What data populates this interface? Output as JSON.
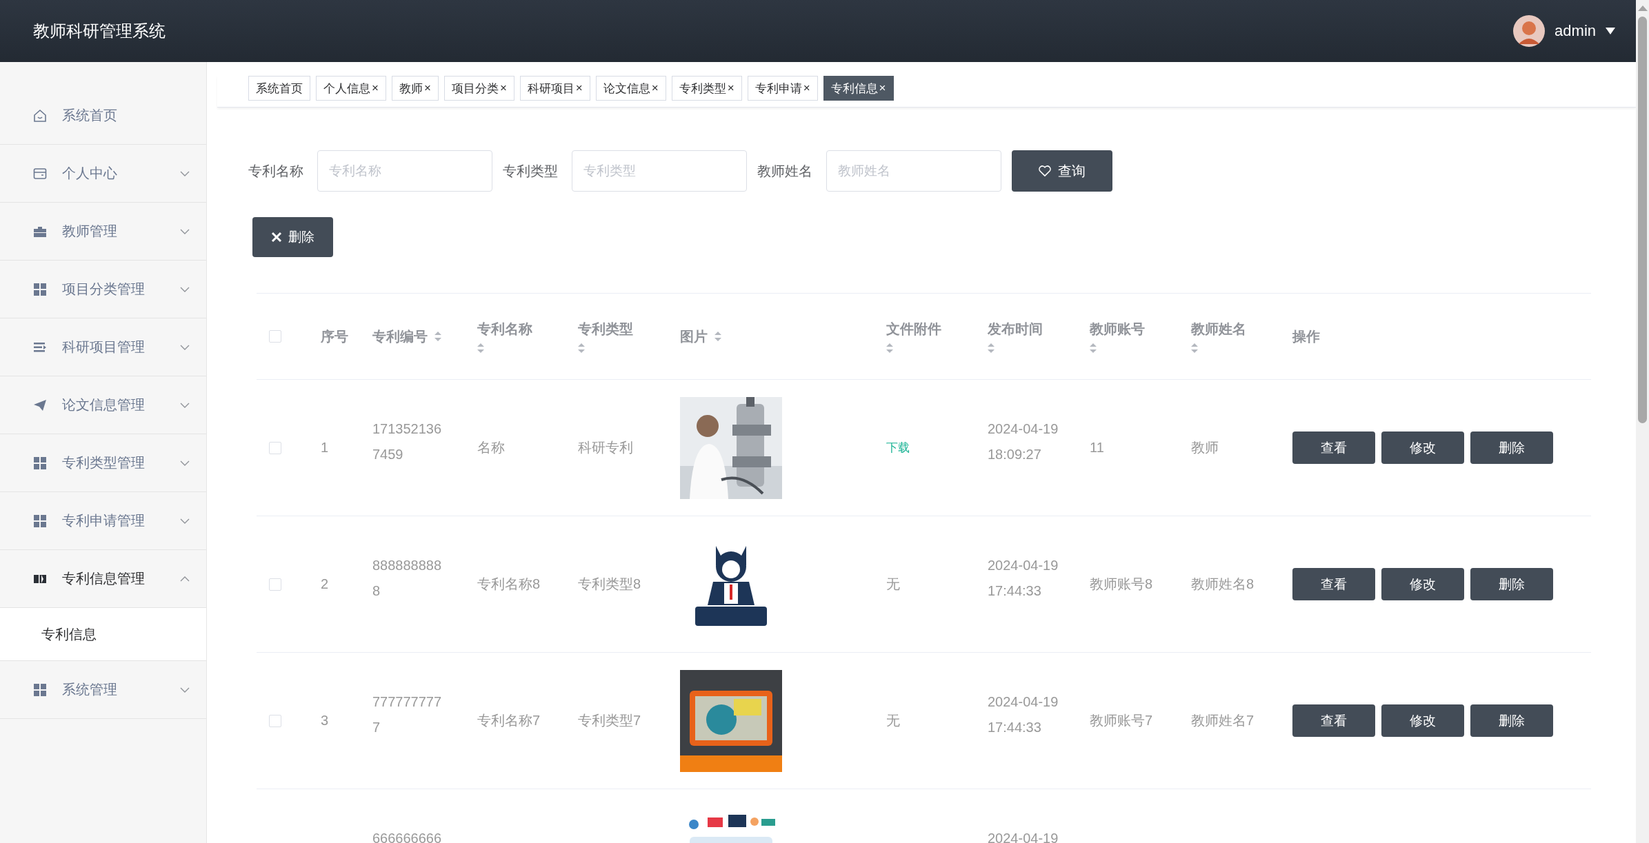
{
  "header": {
    "title": "教师科研管理系统",
    "user": "admin"
  },
  "sidebar": {
    "items": [
      {
        "kind": "link",
        "label": "系统首页"
      },
      {
        "kind": "submenu",
        "label": "个人中心",
        "expanded": false
      },
      {
        "kind": "submenu",
        "label": "教师管理",
        "expanded": false
      },
      {
        "kind": "submenu",
        "label": "项目分类管理",
        "expanded": false
      },
      {
        "kind": "submenu",
        "label": "科研项目管理",
        "expanded": false
      },
      {
        "kind": "submenu",
        "label": "论文信息管理",
        "expanded": false
      },
      {
        "kind": "submenu",
        "label": "专利类型管理",
        "expanded": false
      },
      {
        "kind": "submenu",
        "label": "专利申请管理",
        "expanded": false
      },
      {
        "kind": "submenu",
        "label": "专利信息管理",
        "expanded": true,
        "children": [
          {
            "label": "专利信息",
            "selected": true
          }
        ]
      },
      {
        "kind": "submenu",
        "label": "系统管理",
        "expanded": false
      }
    ]
  },
  "tabs": [
    {
      "label": "系统首页",
      "selected": false
    },
    {
      "label": "个人信息",
      "close": "×",
      "selected": false
    },
    {
      "label": "教师",
      "close": "×",
      "selected": false
    },
    {
      "label": "项目分类",
      "close": "×",
      "selected": false
    },
    {
      "label": "科研项目",
      "close": "×",
      "selected": false
    },
    {
      "label": "论文信息",
      "close": "×",
      "selected": false
    },
    {
      "label": "专利类型",
      "close": "×",
      "selected": false
    },
    {
      "label": "专利申请",
      "close": "×",
      "selected": false
    },
    {
      "label": "专利信息",
      "close": "×",
      "selected": true
    }
  ],
  "search": {
    "fields": [
      {
        "label": "专利名称",
        "placeholder": "专利名称"
      },
      {
        "label": "专利类型",
        "placeholder": "专利类型"
      },
      {
        "label": "教师姓名",
        "placeholder": "教师姓名"
      }
    ],
    "button": "查询"
  },
  "delete_button": "删除",
  "table": {
    "select_all": {
      "checked": false
    },
    "columns": [
      {
        "label": "序号",
        "sortable": false
      },
      {
        "label": "专利编号",
        "sortable": true
      },
      {
        "label": "专利名称",
        "sortable": true
      },
      {
        "label": "专利类型",
        "sortable": true
      },
      {
        "label": "图片",
        "sortable": true
      },
      {
        "label": "文件附件",
        "sortable": true
      },
      {
        "label": "发布时间",
        "sortable": true
      },
      {
        "label": "教师账号",
        "sortable": true
      },
      {
        "label": "教师姓名",
        "sortable": true
      },
      {
        "label": "操作",
        "sortable": false
      }
    ],
    "rows": [
      {
        "checked": false,
        "index": "1",
        "number": "1713521367459",
        "name": "名称",
        "type": "科研专利",
        "attachment": {
          "kind": "link",
          "text": "下载"
        },
        "time": "2024-04-19 18:09:27",
        "account": "11",
        "teacher": "教师",
        "actions": [
          "查看",
          "修改",
          "删除"
        ]
      },
      {
        "checked": false,
        "index": "2",
        "number": "8888888888",
        "name": "专利名称8",
        "type": "专利类型8",
        "attachment": {
          "kind": "text",
          "text": "无"
        },
        "time": "2024-04-19 17:44:33",
        "account": "教师账号8",
        "teacher": "教师姓名8",
        "actions": [
          "查看",
          "修改",
          "删除"
        ]
      },
      {
        "checked": false,
        "index": "3",
        "number": "7777777777",
        "name": "专利名称7",
        "type": "专利类型7",
        "attachment": {
          "kind": "text",
          "text": "无"
        },
        "time": "2024-04-19 17:44:33",
        "account": "教师账号7",
        "teacher": "教师姓名7",
        "actions": [
          "查看",
          "修改",
          "删除"
        ]
      },
      {
        "number": "666666666",
        "time": "2024-04-19"
      }
    ]
  }
}
